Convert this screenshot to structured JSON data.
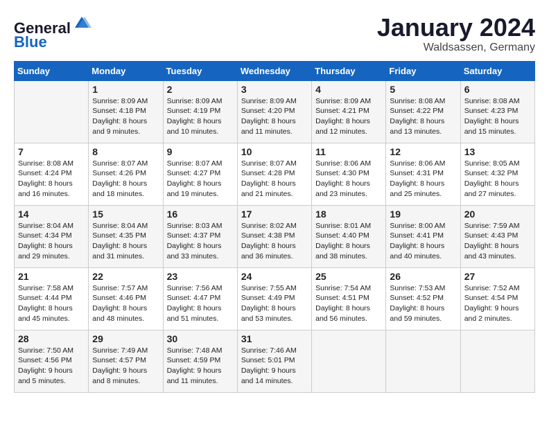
{
  "header": {
    "logo_general": "General",
    "logo_blue": "Blue",
    "month_title": "January 2024",
    "location": "Waldsassen, Germany"
  },
  "calendar": {
    "days_of_week": [
      "Sunday",
      "Monday",
      "Tuesday",
      "Wednesday",
      "Thursday",
      "Friday",
      "Saturday"
    ],
    "weeks": [
      [
        {
          "day": "",
          "info": ""
        },
        {
          "day": "1",
          "info": "Sunrise: 8:09 AM\nSunset: 4:18 PM\nDaylight: 8 hours\nand 9 minutes."
        },
        {
          "day": "2",
          "info": "Sunrise: 8:09 AM\nSunset: 4:19 PM\nDaylight: 8 hours\nand 10 minutes."
        },
        {
          "day": "3",
          "info": "Sunrise: 8:09 AM\nSunset: 4:20 PM\nDaylight: 8 hours\nand 11 minutes."
        },
        {
          "day": "4",
          "info": "Sunrise: 8:09 AM\nSunset: 4:21 PM\nDaylight: 8 hours\nand 12 minutes."
        },
        {
          "day": "5",
          "info": "Sunrise: 8:08 AM\nSunset: 4:22 PM\nDaylight: 8 hours\nand 13 minutes."
        },
        {
          "day": "6",
          "info": "Sunrise: 8:08 AM\nSunset: 4:23 PM\nDaylight: 8 hours\nand 15 minutes."
        }
      ],
      [
        {
          "day": "7",
          "info": "Sunrise: 8:08 AM\nSunset: 4:24 PM\nDaylight: 8 hours\nand 16 minutes."
        },
        {
          "day": "8",
          "info": "Sunrise: 8:07 AM\nSunset: 4:26 PM\nDaylight: 8 hours\nand 18 minutes."
        },
        {
          "day": "9",
          "info": "Sunrise: 8:07 AM\nSunset: 4:27 PM\nDaylight: 8 hours\nand 19 minutes."
        },
        {
          "day": "10",
          "info": "Sunrise: 8:07 AM\nSunset: 4:28 PM\nDaylight: 8 hours\nand 21 minutes."
        },
        {
          "day": "11",
          "info": "Sunrise: 8:06 AM\nSunset: 4:30 PM\nDaylight: 8 hours\nand 23 minutes."
        },
        {
          "day": "12",
          "info": "Sunrise: 8:06 AM\nSunset: 4:31 PM\nDaylight: 8 hours\nand 25 minutes."
        },
        {
          "day": "13",
          "info": "Sunrise: 8:05 AM\nSunset: 4:32 PM\nDaylight: 8 hours\nand 27 minutes."
        }
      ],
      [
        {
          "day": "14",
          "info": "Sunrise: 8:04 AM\nSunset: 4:34 PM\nDaylight: 8 hours\nand 29 minutes."
        },
        {
          "day": "15",
          "info": "Sunrise: 8:04 AM\nSunset: 4:35 PM\nDaylight: 8 hours\nand 31 minutes."
        },
        {
          "day": "16",
          "info": "Sunrise: 8:03 AM\nSunset: 4:37 PM\nDaylight: 8 hours\nand 33 minutes."
        },
        {
          "day": "17",
          "info": "Sunrise: 8:02 AM\nSunset: 4:38 PM\nDaylight: 8 hours\nand 36 minutes."
        },
        {
          "day": "18",
          "info": "Sunrise: 8:01 AM\nSunset: 4:40 PM\nDaylight: 8 hours\nand 38 minutes."
        },
        {
          "day": "19",
          "info": "Sunrise: 8:00 AM\nSunset: 4:41 PM\nDaylight: 8 hours\nand 40 minutes."
        },
        {
          "day": "20",
          "info": "Sunrise: 7:59 AM\nSunset: 4:43 PM\nDaylight: 8 hours\nand 43 minutes."
        }
      ],
      [
        {
          "day": "21",
          "info": "Sunrise: 7:58 AM\nSunset: 4:44 PM\nDaylight: 8 hours\nand 45 minutes."
        },
        {
          "day": "22",
          "info": "Sunrise: 7:57 AM\nSunset: 4:46 PM\nDaylight: 8 hours\nand 48 minutes."
        },
        {
          "day": "23",
          "info": "Sunrise: 7:56 AM\nSunset: 4:47 PM\nDaylight: 8 hours\nand 51 minutes."
        },
        {
          "day": "24",
          "info": "Sunrise: 7:55 AM\nSunset: 4:49 PM\nDaylight: 8 hours\nand 53 minutes."
        },
        {
          "day": "25",
          "info": "Sunrise: 7:54 AM\nSunset: 4:51 PM\nDaylight: 8 hours\nand 56 minutes."
        },
        {
          "day": "26",
          "info": "Sunrise: 7:53 AM\nSunset: 4:52 PM\nDaylight: 8 hours\nand 59 minutes."
        },
        {
          "day": "27",
          "info": "Sunrise: 7:52 AM\nSunset: 4:54 PM\nDaylight: 9 hours\nand 2 minutes."
        }
      ],
      [
        {
          "day": "28",
          "info": "Sunrise: 7:50 AM\nSunset: 4:56 PM\nDaylight: 9 hours\nand 5 minutes."
        },
        {
          "day": "29",
          "info": "Sunrise: 7:49 AM\nSunset: 4:57 PM\nDaylight: 9 hours\nand 8 minutes."
        },
        {
          "day": "30",
          "info": "Sunrise: 7:48 AM\nSunset: 4:59 PM\nDaylight: 9 hours\nand 11 minutes."
        },
        {
          "day": "31",
          "info": "Sunrise: 7:46 AM\nSunset: 5:01 PM\nDaylight: 9 hours\nand 14 minutes."
        },
        {
          "day": "",
          "info": ""
        },
        {
          "day": "",
          "info": ""
        },
        {
          "day": "",
          "info": ""
        }
      ]
    ]
  }
}
